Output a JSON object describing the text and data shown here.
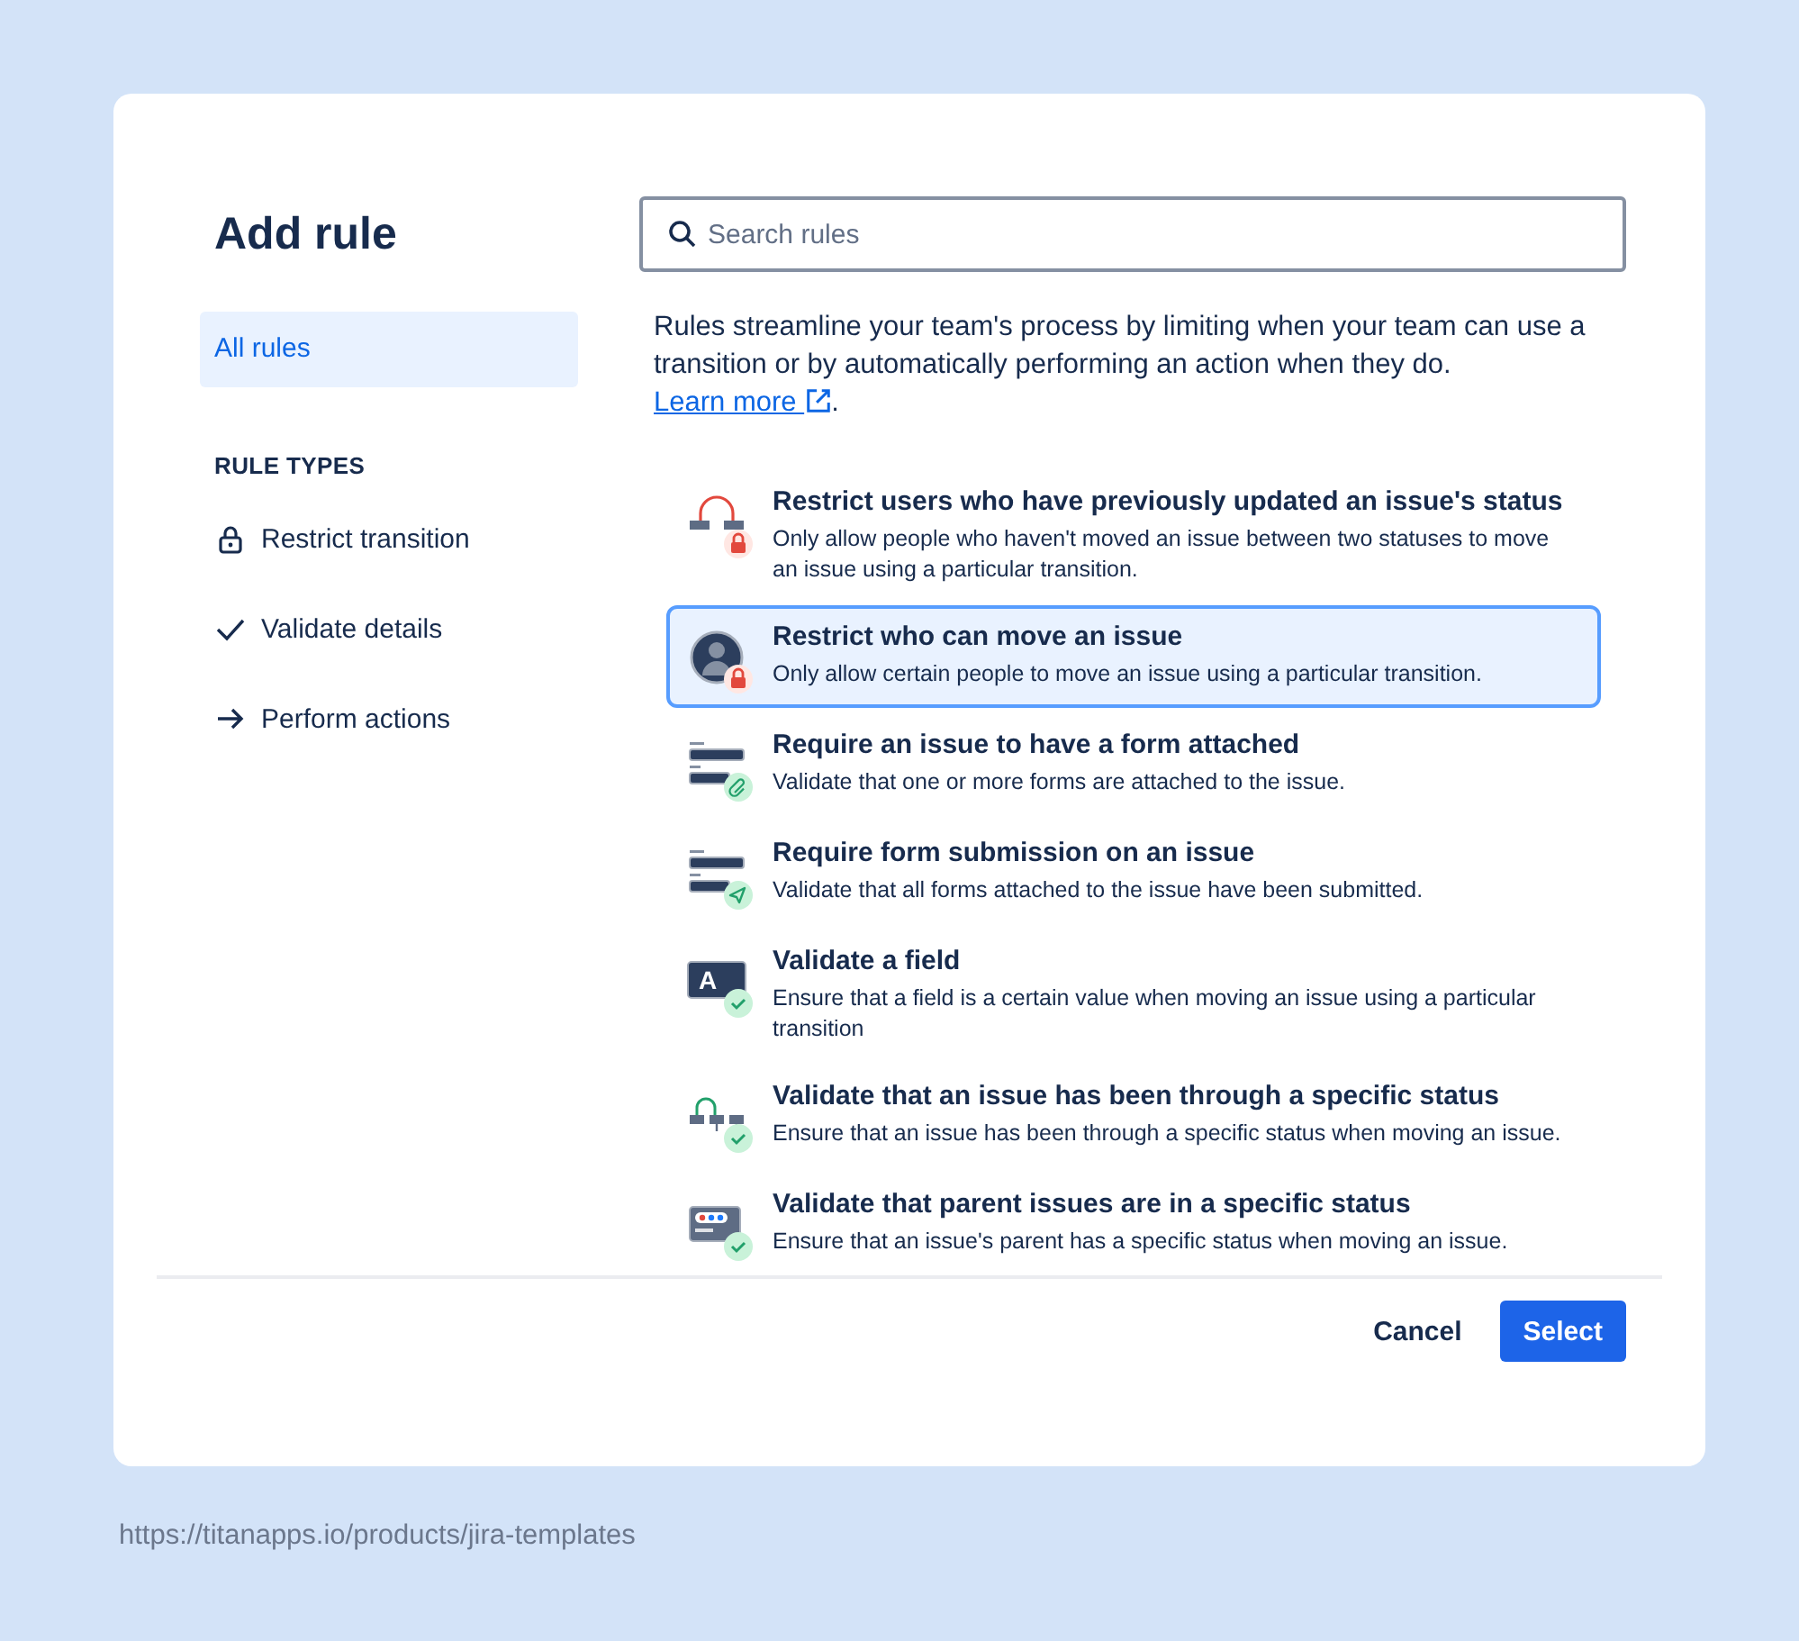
{
  "dialog": {
    "title": "Add rule",
    "sidebar": {
      "items": [
        {
          "label": "All rules",
          "selected": true
        }
      ],
      "section_heading": "RULE TYPES",
      "rule_types": [
        {
          "kind": "restrict",
          "label": "Restrict transition",
          "selected": false
        },
        {
          "kind": "validate",
          "label": "Validate details",
          "selected": false
        },
        {
          "kind": "perform",
          "label": "Perform actions",
          "selected": false
        }
      ]
    },
    "search": {
      "placeholder": "Search rules"
    },
    "description": {
      "text": "Rules streamline your team's process by limiting when your team can use a transition or by automatically performing an action when they do. ",
      "link": "Learn more",
      "after": "."
    },
    "rules": [
      {
        "kind": "history",
        "title": "Restrict users who have previously updated an issue's status",
        "description": "Only allow people who haven't moved an issue between two statuses to move an issue using a particular transition.",
        "selected": false
      },
      {
        "kind": "people",
        "title": "Restrict who can move an issue",
        "description": "Only allow certain people to move an issue using a particular transition.",
        "selected": true
      },
      {
        "kind": "attachment",
        "title": "Require an issue to have a form attached",
        "description": "Validate that one or more forms are attached to the issue.",
        "selected": false
      },
      {
        "kind": "submission",
        "title": "Require form submission on an issue",
        "description": "Validate that all forms attached to the issue have been submitted.",
        "selected": false
      },
      {
        "kind": "field",
        "glyph": "A",
        "title": "Validate a field",
        "description": "Ensure that a field is a certain value when moving an issue using a particular transition",
        "selected": false
      },
      {
        "kind": "path",
        "title": "Validate that an issue has been through a specific status",
        "description": "Ensure that an issue has been through a specific status when moving an issue.",
        "selected": false
      },
      {
        "kind": "parent",
        "title": "Validate that parent issues are in a specific status",
        "description": "Ensure that an issue's parent has a specific status when moving an issue.",
        "selected": false
      }
    ],
    "buttons": [
      {
        "kind": "subtle",
        "label": "Cancel"
      },
      {
        "kind": "primary",
        "label": "Select"
      }
    ]
  },
  "source_url": "https://titanapps.io/products/jira-templates"
}
